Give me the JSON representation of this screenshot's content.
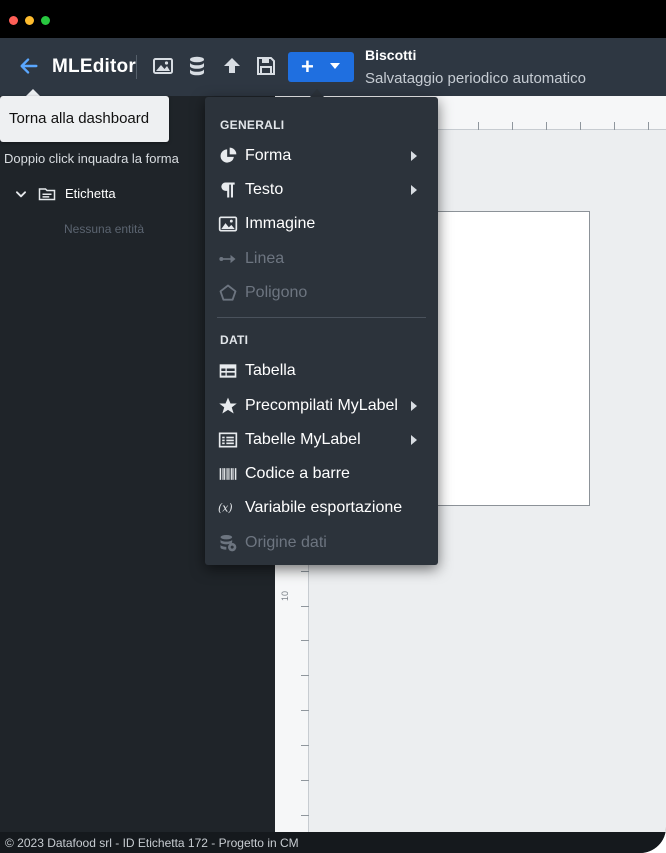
{
  "toolbar": {
    "brand": "MLEditor",
    "add_label": "+",
    "document_title": "Biscotti",
    "document_status": "Salvataggio periodico automatico",
    "accent_color": "#1f6fe0"
  },
  "tooltip": {
    "text": "Torna alla dashboard"
  },
  "sidebar": {
    "hint": "Doppio click inquadra la forma",
    "tree_root": "Etichetta",
    "empty_text": "Nessuna entità"
  },
  "ruler": {
    "left_mark": "10"
  },
  "menu": {
    "sections": [
      {
        "title": "GENERALI"
      },
      {
        "title": "DATI"
      }
    ],
    "items": [
      {
        "label": "Forma",
        "icon": "shapes-icon",
        "submenu": true,
        "disabled": false
      },
      {
        "label": "Testo",
        "icon": "pilcrow-icon",
        "submenu": true,
        "disabled": false
      },
      {
        "label": "Immagine",
        "icon": "image-icon",
        "submenu": false,
        "disabled": false
      },
      {
        "label": "Linea",
        "icon": "line-arrow-icon",
        "submenu": false,
        "disabled": true
      },
      {
        "label": "Poligono",
        "icon": "polygon-icon",
        "submenu": false,
        "disabled": true
      },
      {
        "label": "Tabella",
        "icon": "table-icon",
        "submenu": false,
        "disabled": false
      },
      {
        "label": "Precompilati MyLabel",
        "icon": "star-icon",
        "submenu": true,
        "disabled": false
      },
      {
        "label": "Tabelle MyLabel",
        "icon": "table-list-icon",
        "submenu": true,
        "disabled": false
      },
      {
        "label": "Codice a barre",
        "icon": "barcode-icon",
        "submenu": false,
        "disabled": false
      },
      {
        "label": "Variabile esportazione",
        "icon": "variable-icon",
        "submenu": false,
        "disabled": false
      },
      {
        "label": "Origine dati",
        "icon": "database-settings-icon",
        "submenu": false,
        "disabled": true
      }
    ]
  },
  "footer": {
    "text": "© 2023 Datafood srl - ID Etichetta 172 - Progetto in CM"
  }
}
